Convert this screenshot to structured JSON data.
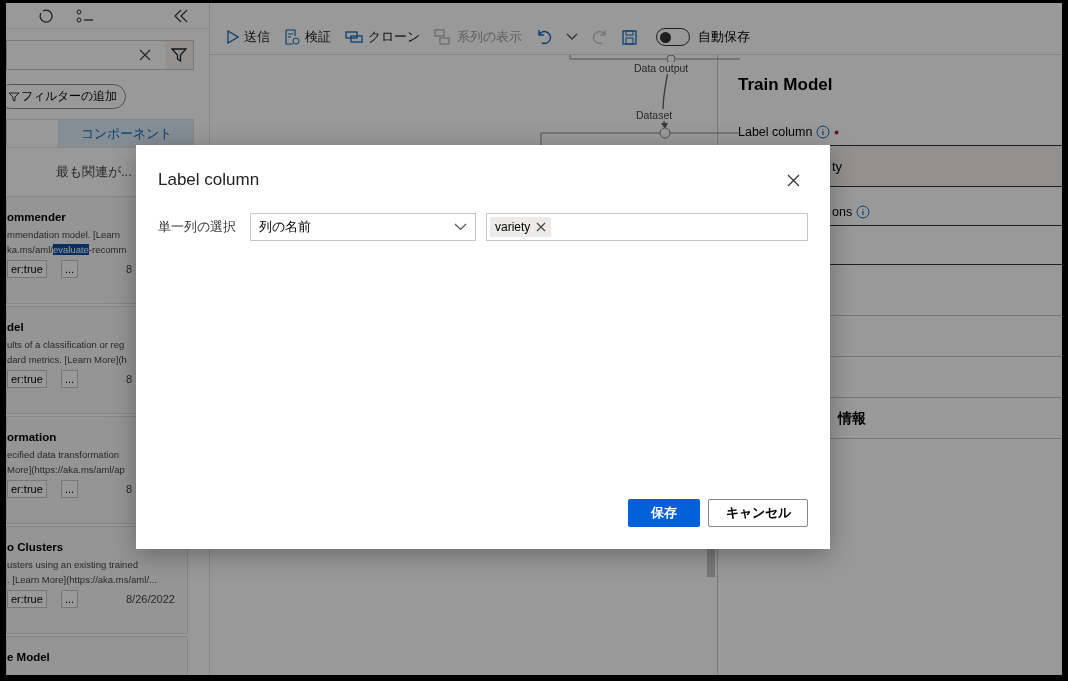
{
  "sidebar": {
    "filter_chip": "フィルターの追加",
    "tabs": [
      {
        "label": "コンポーネント",
        "selected": true
      }
    ],
    "sort_label": "最も関連が...",
    "cards": [
      {
        "title": "ommender",
        "lines": [
          {
            "text": "mmendation model. [Learn"
          },
          {
            "before": "ka.ms/aml/",
            "highlighted": "evaluate",
            "after": "-recomm"
          }
        ],
        "tag": "er:true",
        "more": "...",
        "date": "8"
      },
      {
        "title": "del",
        "lines": [
          {
            "text": "ults of a classification or reg"
          },
          {
            "text": "dard metrics. [Learn More](h"
          }
        ],
        "tag": "er:true",
        "more": "...",
        "date": "8"
      },
      {
        "title": "ormation",
        "lines": [
          {
            "text": "ecified data transformation"
          },
          {
            "text": "More](https://aka.ms/aml/ap"
          }
        ],
        "tag": "er:true",
        "more": "...",
        "date": "8"
      },
      {
        "title": "o Clusters",
        "lines": [
          {
            "text": "usters using an existing trained"
          },
          {
            "text": ". [Learn More](https://aka.ms/aml/..."
          }
        ],
        "tag": "er:true",
        "more": "...",
        "date": "8/26/2022"
      },
      {
        "title": "e Model"
      }
    ]
  },
  "toolbar": {
    "items": [
      {
        "kind": "submit",
        "label": "送信",
        "disabled": false
      },
      {
        "kind": "validate",
        "label": "検証",
        "disabled": false
      },
      {
        "kind": "clone",
        "label": "クローン",
        "disabled": false
      },
      {
        "kind": "lineage",
        "label": "系列の表示",
        "disabled": true
      },
      {
        "kind": "undo",
        "disabled": false
      },
      {
        "kind": "caret",
        "disabled": false
      },
      {
        "kind": "redo",
        "disabled": true
      },
      {
        "kind": "save",
        "disabled": false
      }
    ],
    "autosave": {
      "label": "自動保存",
      "on": false
    }
  },
  "canvas": {
    "ports": [
      "Data output",
      "Dataset"
    ]
  },
  "panel": {
    "title": "Train Model",
    "fields": [
      {
        "label": "Label column",
        "info": true,
        "required": true,
        "value": "ty"
      },
      {
        "label": "ons",
        "info": true,
        "required": false
      }
    ],
    "section": "情報"
  },
  "dialog": {
    "title": "Label column",
    "row_label": "単一列の選択",
    "select_value": "列の名前",
    "tags": [
      "variety"
    ],
    "buttons": [
      {
        "label": "保存",
        "kind": "primary"
      },
      {
        "label": "キャンセル",
        "kind": "default"
      }
    ]
  }
}
